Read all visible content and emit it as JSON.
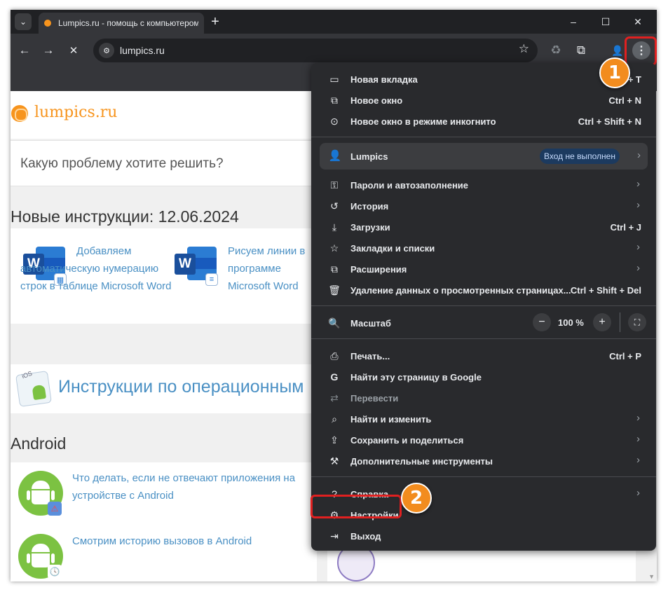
{
  "browser": {
    "tab_title": "Lumpics.ru - помощь с компьютером",
    "tab_search_icon": "chevron-down-icon",
    "new_tab_symbol": "+",
    "window_controls": {
      "minimize": "–",
      "maximize": "☐",
      "close": "✕"
    },
    "nav": {
      "back": "←",
      "forward": "→",
      "stop": "✕"
    },
    "omnibox": {
      "url": "lumpics.ru",
      "site_info_icon": "tune-icon",
      "star": "☆"
    },
    "toolbar_icons": {
      "recycle": "♻",
      "extensions": "⧉",
      "profile": "👤",
      "menu": "⋮"
    }
  },
  "page": {
    "logo_text": "lumpics.ru",
    "search_placeholder": "Какую проблему хотите решить?",
    "new_instructions_heading": "Новые инструкции: 12.06.2024",
    "articles": [
      {
        "title": "Добавляем автоматическую нумерацию строк в таблице Microsoft Word",
        "icon": "word-icon",
        "badge": "▦"
      },
      {
        "title": "Рисуем линии в программе Microsoft Word",
        "icon": "word-icon",
        "badge": "≡"
      }
    ],
    "word_letter": "W",
    "os_title": "Инструкции по операционным",
    "os_icon_label": "iOS",
    "android_heading": "Android",
    "android_articles": [
      {
        "title": "Что делать, если не отвечают приложения на устройстве с Android",
        "badge": "⚠"
      },
      {
        "title": "Смотрим историю вызовов в Android",
        "badge": "🕓"
      }
    ]
  },
  "menu": {
    "group1": [
      {
        "label": "Новая вкладка",
        "shortcut": "Ctrl + T",
        "icon": "new-tab-icon",
        "glyph": "▭"
      },
      {
        "label": "Новое окно",
        "shortcut": "Ctrl + N",
        "icon": "new-window-icon",
        "glyph": "⧉"
      },
      {
        "label": "Новое окно в режиме инкогнито",
        "shortcut": "Ctrl + Shift + N",
        "icon": "incognito-icon",
        "glyph": "⊙"
      }
    ],
    "profile": {
      "name": "Lumpics",
      "status": "Вход не выполнен"
    },
    "group2": [
      {
        "label": "Пароли и автозаполнение",
        "chevron": "›",
        "icon": "key-icon",
        "glyph": "⚿"
      },
      {
        "label": "История",
        "chevron": "›",
        "icon": "history-icon",
        "glyph": "↺"
      },
      {
        "label": "Загрузки",
        "shortcut": "Ctrl + J",
        "icon": "download-icon",
        "glyph": "⤓"
      },
      {
        "label": "Закладки и списки",
        "chevron": "›",
        "icon": "star-icon",
        "glyph": "☆"
      },
      {
        "label": "Расширения",
        "chevron": "›",
        "icon": "puzzle-icon",
        "glyph": "⧉"
      },
      {
        "label": "Удаление данных о просмотренных страницах...",
        "shortcut": "Ctrl + Shift + Del",
        "icon": "trash-icon",
        "glyph": "🗑"
      }
    ],
    "zoom": {
      "label": "Масштаб",
      "value": "100 %",
      "minus": "−",
      "plus": "+",
      "fullscreen": "⛶",
      "icon": "zoom-icon",
      "glyph": "🔍"
    },
    "group3": [
      {
        "label": "Печать...",
        "shortcut": "Ctrl + P",
        "icon": "print-icon",
        "glyph": "⎙"
      },
      {
        "label": "Найти эту страницу в Google",
        "icon": "google-icon",
        "glyph": "G"
      },
      {
        "label": "Перевести",
        "icon": "translate-icon",
        "glyph": "⇄",
        "disabled": true
      },
      {
        "label": "Найти и изменить",
        "chevron": "›",
        "icon": "find-icon",
        "glyph": "⌕"
      },
      {
        "label": "Сохранить и поделиться",
        "chevron": "›",
        "icon": "share-icon",
        "glyph": "⇪"
      },
      {
        "label": "Дополнительные инструменты",
        "chevron": "›",
        "icon": "tools-icon",
        "glyph": "⚒"
      }
    ],
    "group4": [
      {
        "label": "Справка",
        "chevron": "›",
        "icon": "help-icon",
        "glyph": "?"
      },
      {
        "label": "Настройки",
        "icon": "settings-icon",
        "glyph": "⚙"
      },
      {
        "label": "Выход",
        "icon": "exit-icon",
        "glyph": "⇥"
      }
    ]
  },
  "callouts": {
    "first": "1",
    "second": "2"
  },
  "colors": {
    "accent": "#f28c1e",
    "highlight": "#e02020",
    "link": "#4a90c4",
    "menu_bg": "#292a2d"
  }
}
